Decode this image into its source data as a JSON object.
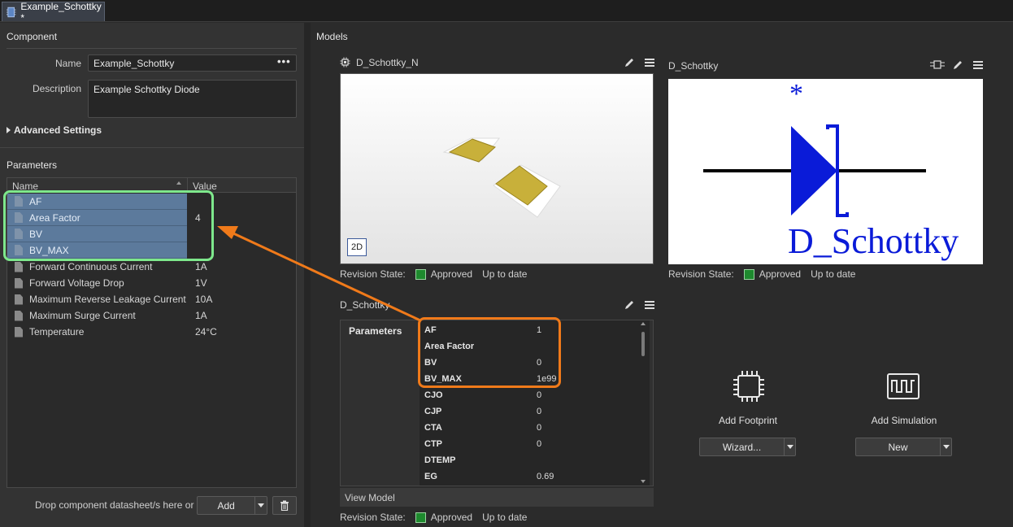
{
  "tab": {
    "title": "Example_Schottky *"
  },
  "component": {
    "section_title": "Component",
    "name_label": "Name",
    "name_value": "Example_Schottky",
    "more_icon": "ellipsis-icon",
    "description_label": "Description",
    "description_value": "Example Schottky Diode",
    "advanced_label": "Advanced Settings"
  },
  "parameters": {
    "section_title": "Parameters",
    "col_name": "Name",
    "col_value": "Value",
    "rows": [
      {
        "name": "AF",
        "value": "",
        "selected": true
      },
      {
        "name": "Area Factor",
        "value": "4",
        "selected": true
      },
      {
        "name": "BV",
        "value": "",
        "selected": true
      },
      {
        "name": "BV_MAX",
        "value": "",
        "selected": true
      },
      {
        "name": "Forward Continuous Current",
        "value": "1A",
        "selected": false
      },
      {
        "name": "Forward Voltage Drop",
        "value": "1V",
        "selected": false
      },
      {
        "name": "Maximum Reverse Leakage Current",
        "value": "10A",
        "selected": false
      },
      {
        "name": "Maximum Surge Current",
        "value": "1A",
        "selected": false
      },
      {
        "name": "Temperature",
        "value": "24°C",
        "selected": false
      }
    ]
  },
  "datasheet": {
    "drop_text": "Drop component datasheet/s here or",
    "add_label": "Add"
  },
  "models": {
    "section_title": "Models",
    "footprint": {
      "title": "D_Schottky_N",
      "view_label": "2D"
    },
    "symbol": {
      "title": "D_Schottky",
      "symbol_text": "D_Schottky",
      "star": "*"
    },
    "revision": {
      "label": "Revision State:",
      "state": "Approved",
      "status": "Up to date"
    },
    "sim": {
      "title": "D_Schottky",
      "params_label": "Parameters",
      "rows": [
        {
          "name": "AF",
          "value": "1"
        },
        {
          "name": "Area Factor",
          "value": ""
        },
        {
          "name": "BV",
          "value": "0"
        },
        {
          "name": "BV_MAX",
          "value": "1e99"
        },
        {
          "name": "CJO",
          "value": "0"
        },
        {
          "name": "CJP",
          "value": "0"
        },
        {
          "name": "CTA",
          "value": "0"
        },
        {
          "name": "CTP",
          "value": "0"
        },
        {
          "name": "DTEMP",
          "value": ""
        },
        {
          "name": "EG",
          "value": "0.69"
        }
      ],
      "view_model": "View Model"
    },
    "add_footprint": {
      "label": "Add Footprint",
      "button": "Wizard..."
    },
    "add_simulation": {
      "label": "Add Simulation",
      "button": "New"
    }
  },
  "colors": {
    "highlight_green": "#7ee88c",
    "highlight_orange": "#f07a1a",
    "selection": "#5c7a9c",
    "approved": "#1e8a2e",
    "symbol_blue": "#0a1bd8"
  }
}
